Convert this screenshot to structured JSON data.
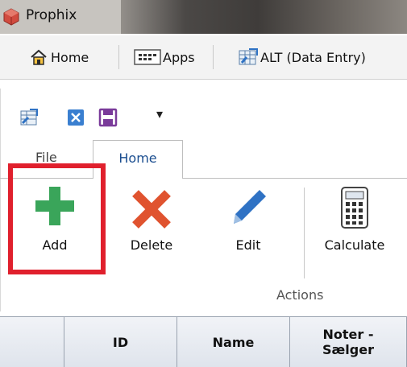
{
  "titlebar": {
    "title": "Prophix",
    "icon": "prophix-logo-icon"
  },
  "nav": {
    "items": [
      {
        "label": "Home",
        "icon": "home-icon"
      },
      {
        "label": "Apps",
        "icon": "apps-icon"
      },
      {
        "label": "ALT (Data Entry)",
        "icon": "data-entry-icon"
      }
    ]
  },
  "quick_access": {
    "icons": [
      "data-entry-icon",
      "close-icon",
      "save-icon"
    ],
    "dropdown": "▾"
  },
  "ribbon": {
    "tabs": [
      {
        "label": "File",
        "active": false
      },
      {
        "label": "Home",
        "active": true
      }
    ],
    "actions": [
      {
        "label": "Add",
        "icon": "plus-icon",
        "highlighted": true
      },
      {
        "label": "Delete",
        "icon": "x-icon"
      },
      {
        "label": "Edit",
        "icon": "pencil-icon"
      },
      {
        "label": "Calculate",
        "icon": "calculator-icon"
      }
    ],
    "group_label": "Actions"
  },
  "table": {
    "columns": [
      "",
      "ID",
      "Name",
      "Noter -\nSælger"
    ]
  },
  "colors": {
    "highlight": "#e0202d",
    "add_green": "#3aa55a",
    "delete_red": "#e0532f",
    "edit_blue": "#2f72c4"
  }
}
